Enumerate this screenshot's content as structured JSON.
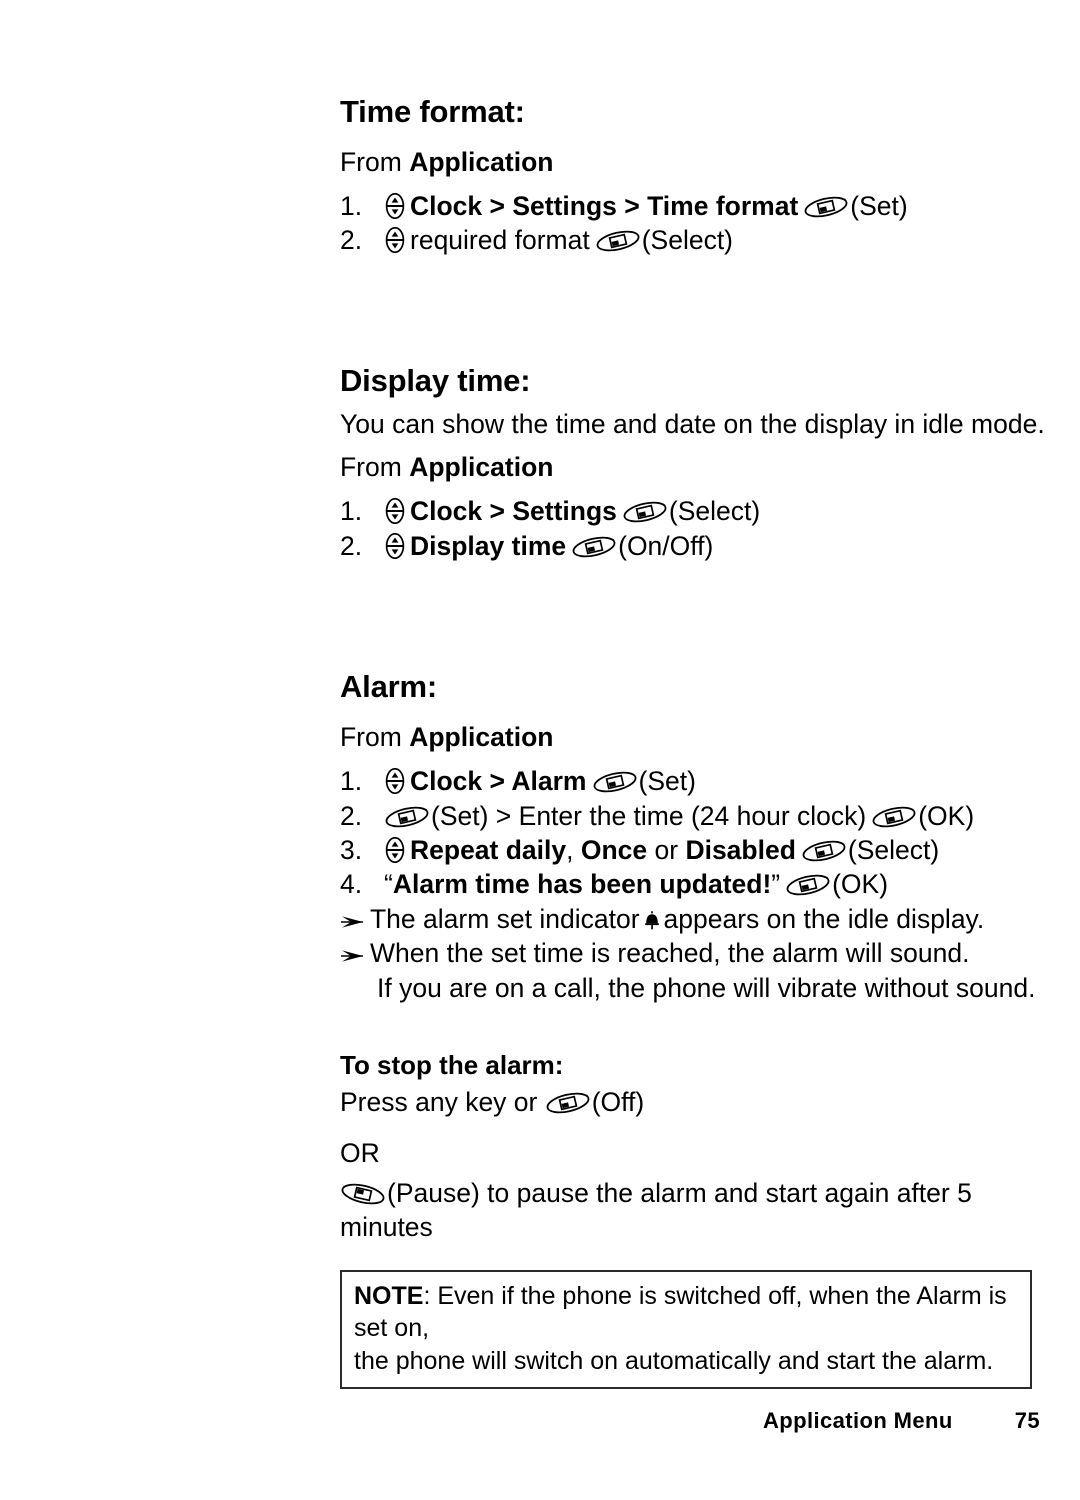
{
  "page": {
    "footer_title": "Application Menu",
    "footer_page_number": "75"
  },
  "icons": {
    "nav_key": "navigation-key-icon",
    "soft_key": "soft-key-icon",
    "soft_key_flipped": "soft-key-flipped-icon",
    "alarm_indicator": "alarm-bell-icon",
    "bullet_arrow": "arrow-bullet-icon"
  },
  "sections": [
    {
      "id": "time-format",
      "heading": "Time format:",
      "from_prefix": "From ",
      "from_target": "Application",
      "steps": [
        {
          "num": "1.",
          "nav": true,
          "bold_text": "Clock > Settings > Time format",
          "softkey_label": "(Set)"
        },
        {
          "num": "2.",
          "nav": true,
          "plain_text": "required format",
          "softkey_label": "(Select)"
        }
      ]
    },
    {
      "id": "display-time",
      "heading": "Display time:",
      "intro": "You can show the time and date on the display in idle mode.",
      "from_prefix": "From ",
      "from_target": "Application",
      "steps": [
        {
          "num": "1.",
          "nav": true,
          "bold_text": "Clock > Settings",
          "softkey_label": "(Select)"
        },
        {
          "num": "2.",
          "nav": true,
          "bold_text": "Display time",
          "softkey_label": "(On/Off)"
        }
      ]
    },
    {
      "id": "alarm",
      "heading": "Alarm:",
      "from_prefix": "From ",
      "from_target": "Application",
      "steps": [
        {
          "num": "1.",
          "nav": true,
          "bold_text": "Clock > Alarm",
          "softkey_label": "(Set)"
        },
        {
          "num": "2.",
          "lead_softkey_label": "(Set)",
          "plain_text": " > Enter the time (24 hour clock)",
          "softkey_label": "(OK)"
        },
        {
          "num": "3.",
          "nav": true,
          "bold_a": "Repeat daily",
          "sep_a": ", ",
          "bold_b": "Once",
          "sep_b": " or ",
          "bold_c": "Disabled",
          "softkey_label": "(Select)"
        },
        {
          "num": "4.",
          "quote_open": "“",
          "bold_text": "Alarm time has been updated!",
          "quote_close": "”",
          "softkey_label": "(OK)"
        }
      ],
      "bullets": [
        {
          "pre": "The alarm set indicator",
          "has_bell": true,
          "post": "appears on the idle display."
        },
        {
          "pre": "When the set time is reached, the alarm will sound.",
          "has_bell": false,
          "post": ""
        }
      ],
      "continuation": "If you are on a call, the phone will vibrate without sound."
    }
  ],
  "stop_alarm": {
    "heading": "To stop the alarm:",
    "press_line_pre": "Press any key or ",
    "press_softkey_label": "(Off)",
    "or_label": "OR",
    "pause_softkey_label": "(Pause)",
    "pause_text": " to pause the alarm and start again after 5 minutes"
  },
  "note": {
    "label": "NOTE",
    "line1_rest": ": Even if the phone is switched off, when the Alarm is set on,",
    "line2": "the phone will switch on automatically and start the alarm."
  }
}
